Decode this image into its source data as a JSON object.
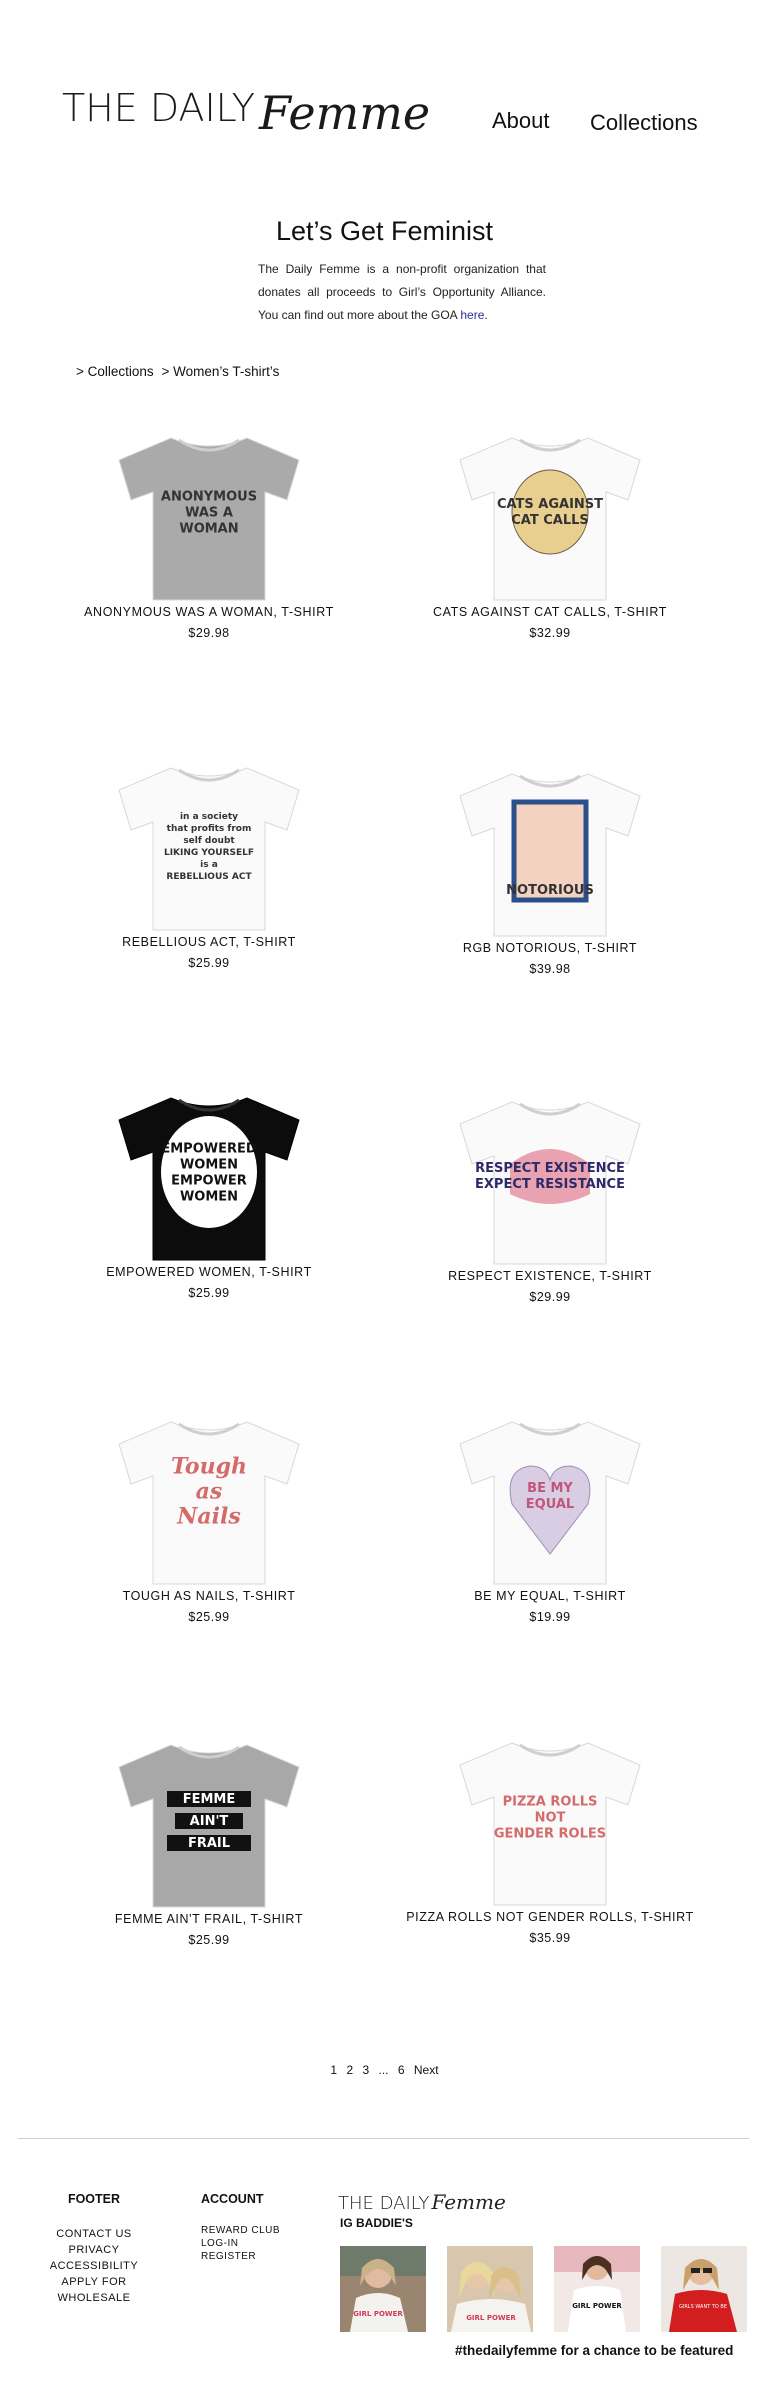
{
  "header": {
    "logo_main": "THE DAILY",
    "logo_script": "Femme",
    "nav": {
      "about": "About",
      "collections": "Collections"
    }
  },
  "intro": {
    "title": "Let’s Get Feminist",
    "text": "The Daily Femme is a non-profit organization that donates all proceeds to Girl’s Opportunity Alliance. You can find out more about the GOA",
    "link": "here",
    "after_link": "."
  },
  "breadcrumb": {
    "item1": "> Collections",
    "item2": "> Women’s T-shirt’s"
  },
  "products": [
    {
      "name": "ANONYMOUS WAS A WOMAN, T-SHIRT",
      "price": "$29.98",
      "shirt_color": "#aaaaaa",
      "graphic": [
        "ANONYMOUS",
        "WAS A",
        "WOMAN"
      ]
    },
    {
      "name": "CATS AGAINST CAT CALLS, T-SHIRT",
      "price": "$32.99",
      "shirt_color": "#fafafa",
      "graphic": [
        "CATS AGAINST",
        "CAT CALLS"
      ]
    },
    {
      "name": "REBELLIOUS ACT, T-SHIRT",
      "price": "$25.99",
      "shirt_color": "#fafafa",
      "graphic": [
        "in a society",
        "that profits from",
        "self doubt",
        "LIKING YOURSELF",
        "is a",
        "REBELLIOUS ACT"
      ]
    },
    {
      "name": "RGB NOTORIOUS, T-SHIRT",
      "price": "$39.98",
      "shirt_color": "#fafafa",
      "graphic": [
        "NOTORIOUS"
      ]
    },
    {
      "name": "EMPOWERED WOMEN, T-SHIRT",
      "price": "$25.99",
      "shirt_color": "#0c0c0c",
      "graphic": [
        "EMPOWERED",
        "WOMEN",
        "EMPOWER",
        "WOMEN"
      ]
    },
    {
      "name": "RESPECT EXISTENCE, T-SHIRT",
      "price": "$29.99",
      "shirt_color": "#fafafa",
      "graphic": [
        "RESPECT EXISTENCE",
        "EXPECT RESISTANCE"
      ]
    },
    {
      "name": "TOUGH AS NAILS, T-SHIRT",
      "price": "$25.99",
      "shirt_color": "#fafafa",
      "graphic": [
        "Tough",
        "as",
        "Nails"
      ]
    },
    {
      "name": "BE MY EQUAL, T-SHIRT",
      "price": "$19.99",
      "shirt_color": "#fafafa",
      "graphic": [
        "BE MY",
        "EQUAL"
      ]
    },
    {
      "name": "FEMME AIN'T FRAIL, T-SHIRT",
      "price": "$25.99",
      "shirt_color": "#a8a8a8",
      "graphic": [
        "FEMME",
        "AIN'T",
        "FRAIL"
      ]
    },
    {
      "name": "PIZZA ROLLS NOT GENDER ROLLS, T-SHIRT",
      "price": "$35.99",
      "shirt_color": "#fafafa",
      "graphic": [
        "PIZZA ROLLS",
        "NOT",
        "GENDER ROLES"
      ]
    }
  ],
  "pagination": {
    "p1": "1",
    "p2": "2",
    "p3": "3",
    "ellipsis": "...",
    "p6": "6",
    "next": "Next"
  },
  "footer": {
    "col1": {
      "head": "FOOTER",
      "links": [
        "CONTACT US",
        "PRIVACY",
        "ACCESSIBILITY",
        "APPLY FOR",
        "WHOLESALE"
      ]
    },
    "col2": {
      "head": "ACCOUNT",
      "links": [
        "REWARD CLUB",
        "LOG-IN",
        "REGISTER"
      ]
    },
    "logo_main": "THE DAILY",
    "logo_script": "Femme",
    "ig_title": "IG BADDIE'S",
    "ig_captions": [
      "GIRL POWER",
      "GIRL POWER",
      "GIRL POWER",
      "GIRLS WANT TO BE"
    ],
    "hashtag": "#thedailyfemme for a chance to be featured"
  }
}
